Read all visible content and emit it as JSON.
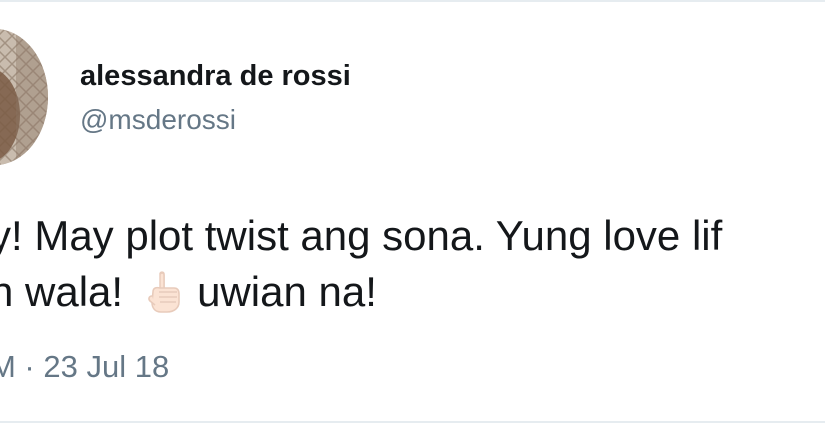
{
  "tweet": {
    "author": {
      "display_name": "alessandra de rossi",
      "handle": "@msderossi"
    },
    "text": {
      "line1": "y! May plot twist ang sona. Yung love lif",
      "line2_a": "n wala!",
      "emoji": "pointing-up-hand-icon",
      "line2_b": "uwian na!"
    },
    "timestamp": "M · 23 Jul 18"
  },
  "colors": {
    "text": "#14171a",
    "muted": "#657786",
    "border": "#e6ecf0"
  }
}
